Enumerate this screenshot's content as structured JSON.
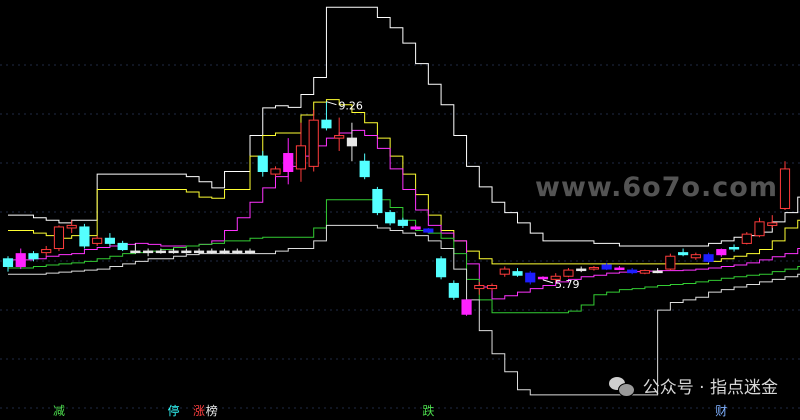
{
  "chart_data": {
    "type": "candlestick",
    "title": "",
    "xlabel": "",
    "ylabel": "",
    "grid": true,
    "ylim": [
      3.45,
      11.24
    ],
    "annotations": [
      {
        "text": "9.26",
        "kind": "high",
        "index": 25,
        "value": 9.26
      },
      {
        "text": "5.79",
        "kind": "low",
        "index": 42,
        "value": 5.79
      }
    ],
    "candles": [
      {
        "o": 6.05,
        "h": 6.25,
        "l": 5.95,
        "c": 6.2,
        "color": "cyan"
      },
      {
        "o": 6.05,
        "h": 6.4,
        "l": 6.0,
        "c": 6.3,
        "color": "magenta"
      },
      {
        "o": 6.3,
        "h": 6.35,
        "l": 6.15,
        "c": 6.2,
        "color": "cyan"
      },
      {
        "o": 6.32,
        "h": 6.45,
        "l": 6.25,
        "c": 6.38,
        "color": "red"
      },
      {
        "o": 6.4,
        "h": 6.85,
        "l": 6.35,
        "c": 6.82,
        "color": "red"
      },
      {
        "o": 6.8,
        "h": 6.95,
        "l": 6.7,
        "c": 6.85,
        "color": "red"
      },
      {
        "o": 6.82,
        "h": 6.88,
        "l": 6.4,
        "c": 6.45,
        "color": "cyan"
      },
      {
        "o": 6.5,
        "h": 6.65,
        "l": 6.45,
        "c": 6.6,
        "color": "red"
      },
      {
        "o": 6.6,
        "h": 6.7,
        "l": 6.45,
        "c": 6.5,
        "color": "cyan"
      },
      {
        "o": 6.5,
        "h": 6.55,
        "l": 6.35,
        "c": 6.38,
        "color": "cyan"
      },
      {
        "o": 6.35,
        "h": 6.5,
        "l": 6.3,
        "c": 6.35,
        "color": "white"
      },
      {
        "o": 6.35,
        "h": 6.4,
        "l": 6.25,
        "c": 6.35,
        "color": "white"
      },
      {
        "o": 6.35,
        "h": 6.4,
        "l": 6.3,
        "c": 6.35,
        "color": "white"
      },
      {
        "o": 6.35,
        "h": 6.4,
        "l": 6.3,
        "c": 6.35,
        "color": "white"
      },
      {
        "o": 6.35,
        "h": 6.4,
        "l": 6.3,
        "c": 6.35,
        "color": "white"
      },
      {
        "o": 6.35,
        "h": 6.4,
        "l": 6.3,
        "c": 6.35,
        "color": "white"
      },
      {
        "o": 6.35,
        "h": 6.4,
        "l": 6.3,
        "c": 6.35,
        "color": "white"
      },
      {
        "o": 6.35,
        "h": 6.4,
        "l": 6.3,
        "c": 6.35,
        "color": "white"
      },
      {
        "o": 6.35,
        "h": 6.4,
        "l": 6.3,
        "c": 6.35,
        "color": "white"
      },
      {
        "o": 6.35,
        "h": 6.4,
        "l": 6.3,
        "c": 6.35,
        "color": "white"
      },
      {
        "o": 8.2,
        "h": 8.3,
        "l": 7.8,
        "c": 7.9,
        "color": "cyan"
      },
      {
        "o": 7.85,
        "h": 8.0,
        "l": 7.8,
        "c": 7.95,
        "color": "red"
      },
      {
        "o": 8.25,
        "h": 8.55,
        "l": 7.65,
        "c": 7.9,
        "color": "magenta"
      },
      {
        "o": 7.95,
        "h": 8.85,
        "l": 7.7,
        "c": 8.4,
        "color": "red"
      },
      {
        "o": 8.0,
        "h": 9.1,
        "l": 7.9,
        "c": 8.9,
        "color": "red"
      },
      {
        "o": 8.9,
        "h": 9.26,
        "l": 8.7,
        "c": 8.75,
        "color": "cyan"
      },
      {
        "o": 8.55,
        "h": 8.95,
        "l": 8.3,
        "c": 8.6,
        "color": "red"
      },
      {
        "o": 8.55,
        "h": 8.85,
        "l": 8.1,
        "c": 8.4,
        "color": "white"
      },
      {
        "o": 8.1,
        "h": 8.25,
        "l": 7.75,
        "c": 7.8,
        "color": "cyan"
      },
      {
        "o": 7.55,
        "h": 7.6,
        "l": 7.05,
        "c": 7.1,
        "color": "cyan"
      },
      {
        "o": 7.1,
        "h": 7.15,
        "l": 6.85,
        "c": 6.9,
        "color": "cyan"
      },
      {
        "o": 6.95,
        "h": 7.0,
        "l": 6.8,
        "c": 6.85,
        "color": "cyan"
      },
      {
        "o": 6.82,
        "h": 6.86,
        "l": 6.76,
        "c": 6.78,
        "color": "magenta"
      },
      {
        "o": 6.78,
        "h": 6.8,
        "l": 6.7,
        "c": 6.72,
        "color": "blue"
      },
      {
        "o": 6.2,
        "h": 6.25,
        "l": 5.8,
        "c": 5.85,
        "color": "cyan"
      },
      {
        "o": 5.72,
        "h": 5.78,
        "l": 5.4,
        "c": 5.45,
        "color": "cyan"
      },
      {
        "o": 5.4,
        "h": 5.4,
        "l": 5.09,
        "c": 5.12,
        "color": "magenta"
      },
      {
        "o": 5.62,
        "h": 5.75,
        "l": 5.5,
        "c": 5.68,
        "color": "red"
      },
      {
        "o": 5.62,
        "h": 5.72,
        "l": 5.58,
        "c": 5.68,
        "color": "red"
      },
      {
        "o": 5.9,
        "h": 6.05,
        "l": 5.85,
        "c": 6.0,
        "color": "red"
      },
      {
        "o": 5.95,
        "h": 6.02,
        "l": 5.85,
        "c": 5.88,
        "color": "cyan"
      },
      {
        "o": 5.92,
        "h": 5.96,
        "l": 5.7,
        "c": 5.75,
        "color": "blue"
      },
      {
        "o": 5.82,
        "h": 5.86,
        "l": 5.79,
        "c": 5.84,
        "color": "magenta"
      },
      {
        "o": 5.8,
        "h": 5.92,
        "l": 5.75,
        "c": 5.86,
        "color": "red"
      },
      {
        "o": 5.86,
        "h": 6.02,
        "l": 5.84,
        "c": 5.98,
        "color": "red"
      },
      {
        "o": 5.98,
        "h": 6.05,
        "l": 5.94,
        "c": 6.0,
        "color": "white"
      },
      {
        "o": 6.0,
        "h": 6.06,
        "l": 5.97,
        "c": 6.03,
        "color": "red"
      },
      {
        "o": 6.08,
        "h": 6.12,
        "l": 5.98,
        "c": 6.0,
        "color": "blue"
      },
      {
        "o": 6.02,
        "h": 6.06,
        "l": 5.98,
        "c": 6.0,
        "color": "magenta"
      },
      {
        "o": 5.98,
        "h": 6.02,
        "l": 5.9,
        "c": 5.93,
        "color": "blue"
      },
      {
        "o": 5.92,
        "h": 5.99,
        "l": 5.9,
        "c": 5.97,
        "color": "red"
      },
      {
        "o": 5.96,
        "h": 6.02,
        "l": 5.92,
        "c": 5.96,
        "color": "white"
      },
      {
        "o": 6.0,
        "h": 6.3,
        "l": 5.98,
        "c": 6.25,
        "color": "red"
      },
      {
        "o": 6.32,
        "h": 6.4,
        "l": 6.25,
        "c": 6.28,
        "color": "cyan"
      },
      {
        "o": 6.22,
        "h": 6.32,
        "l": 6.18,
        "c": 6.28,
        "color": "red"
      },
      {
        "o": 6.28,
        "h": 6.32,
        "l": 6.12,
        "c": 6.15,
        "color": "blue"
      },
      {
        "o": 6.28,
        "h": 6.4,
        "l": 6.24,
        "c": 6.38,
        "color": "magenta"
      },
      {
        "o": 6.4,
        "h": 6.48,
        "l": 6.34,
        "c": 6.42,
        "color": "cyan"
      },
      {
        "o": 6.5,
        "h": 6.72,
        "l": 6.48,
        "c": 6.68,
        "color": "red"
      },
      {
        "o": 6.65,
        "h": 7.0,
        "l": 6.62,
        "c": 6.92,
        "color": "red"
      },
      {
        "o": 6.85,
        "h": 7.05,
        "l": 6.8,
        "c": 6.9,
        "color": "red"
      },
      {
        "o": 7.18,
        "h": 8.1,
        "l": 7.15,
        "c": 7.95,
        "color": "red"
      }
    ],
    "series": [
      {
        "color": "#ffffff",
        "values": [
          7.05,
          7.05,
          7.0,
          6.95,
          6.9,
          6.95,
          6.95,
          7.85,
          7.85,
          7.85,
          7.85,
          7.85,
          7.85,
          7.85,
          7.8,
          7.7,
          7.58,
          7.9,
          7.9,
          8.6,
          9.14,
          9.18,
          9.15,
          9.4,
          9.73,
          11.1,
          11.1,
          11.1,
          11.1,
          10.9,
          10.7,
          10.4,
          10.0,
          9.6,
          9.2,
          8.6,
          8.0,
          7.6,
          7.3,
          7.1,
          6.9,
          6.7,
          6.55,
          6.55,
          6.55,
          6.55,
          6.5,
          6.5,
          6.45,
          6.45,
          6.45,
          6.45,
          6.45,
          6.45,
          6.45,
          6.5,
          6.55,
          6.62,
          6.65,
          6.72,
          6.92,
          7.1,
          7.4,
          8.2
        ]
      },
      {
        "color": "#ffff33",
        "values": [
          6.75,
          6.75,
          6.7,
          6.65,
          6.6,
          6.65,
          6.65,
          7.55,
          7.55,
          7.55,
          7.55,
          7.55,
          7.55,
          7.55,
          7.5,
          7.4,
          7.38,
          7.55,
          7.55,
          8.2,
          8.6,
          8.65,
          8.65,
          9.0,
          9.25,
          9.3,
          9.2,
          9.05,
          8.85,
          8.55,
          8.2,
          7.85,
          7.45,
          7.05,
          6.75,
          6.55,
          6.35,
          6.2,
          6.1,
          6.1,
          6.1,
          6.1,
          6.1,
          6.1,
          6.1,
          6.1,
          6.1,
          6.1,
          6.1,
          6.1,
          6.1,
          6.1,
          6.1,
          6.1,
          6.1,
          6.15,
          6.2,
          6.25,
          6.3,
          6.38,
          6.55,
          6.8,
          6.95,
          7.45
        ]
      },
      {
        "color": "#ff33ff",
        "values": [
          6.18,
          6.18,
          6.2,
          6.25,
          6.28,
          6.3,
          6.38,
          6.42,
          6.45,
          6.48,
          6.5,
          6.48,
          6.45,
          6.45,
          6.45,
          6.48,
          6.55,
          6.75,
          7.0,
          7.3,
          7.58,
          7.8,
          8.0,
          8.2,
          8.4,
          8.55,
          8.65,
          8.7,
          8.6,
          8.35,
          7.95,
          7.55,
          7.15,
          6.85,
          6.7,
          6.55,
          6.1,
          5.65,
          5.42,
          5.48,
          5.55,
          5.62,
          5.68,
          5.75,
          5.8,
          5.85,
          5.88,
          5.92,
          5.94,
          5.95,
          5.96,
          5.97,
          5.97,
          5.98,
          6.0,
          6.02,
          6.05,
          6.08,
          6.12,
          6.18,
          6.24,
          6.3,
          6.4,
          6.7
        ]
      },
      {
        "color": "#33cc33",
        "values": [
          6.02,
          6.02,
          6.05,
          6.08,
          6.1,
          6.12,
          6.15,
          6.2,
          6.25,
          6.3,
          6.32,
          6.35,
          6.38,
          6.42,
          6.45,
          6.48,
          6.5,
          6.55,
          6.55,
          6.6,
          6.62,
          6.62,
          6.62,
          6.62,
          6.8,
          7.35,
          7.35,
          7.35,
          7.35,
          7.35,
          7.2,
          6.95,
          6.75,
          6.7,
          6.6,
          6.3,
          5.8,
          5.4,
          5.15,
          5.15,
          5.15,
          5.15,
          5.15,
          5.15,
          5.18,
          5.3,
          5.5,
          5.55,
          5.6,
          5.62,
          5.65,
          5.68,
          5.7,
          5.72,
          5.75,
          5.78,
          5.82,
          5.85,
          5.88,
          5.9,
          5.95,
          6.0,
          6.05,
          6.05
        ]
      },
      {
        "color": "#dddddd",
        "values": [
          5.9,
          5.9,
          5.9,
          5.92,
          5.94,
          5.96,
          5.98,
          6.0,
          6.05,
          6.1,
          6.15,
          6.2,
          6.2,
          6.25,
          6.28,
          6.3,
          6.3,
          6.3,
          6.3,
          6.3,
          6.3,
          6.35,
          6.4,
          6.4,
          6.55,
          6.85,
          6.85,
          6.85,
          6.85,
          6.8,
          6.75,
          6.7,
          6.65,
          6.55,
          6.4,
          6.0,
          5.4,
          4.8,
          4.35,
          4.0,
          3.65,
          3.55,
          3.55,
          3.55,
          3.55,
          3.55,
          3.55,
          3.55,
          3.55,
          3.55,
          3.55,
          5.2,
          5.35,
          5.4,
          5.45,
          5.55,
          5.6,
          5.65,
          5.7,
          5.75,
          5.8,
          5.85,
          5.9,
          5.95
        ]
      }
    ],
    "signals": [
      {
        "text": "减",
        "color": "#4cdb4c",
        "index": 4
      },
      {
        "text": "停",
        "color": "#33ffff",
        "index": 13
      },
      {
        "text": "涨",
        "color": "#ff4040",
        "index": 15
      },
      {
        "text": "榜",
        "color": "#e8e8e8",
        "index": 16
      },
      {
        "text": "跌",
        "color": "#4cdb4c",
        "index": 33
      },
      {
        "text": "财",
        "color": "#7fb0ff",
        "index": 56
      }
    ]
  },
  "watermark": "www.6o7o.com",
  "wechat": {
    "icon": "wechat-icon",
    "text": "公众号 · 指点迷金"
  }
}
